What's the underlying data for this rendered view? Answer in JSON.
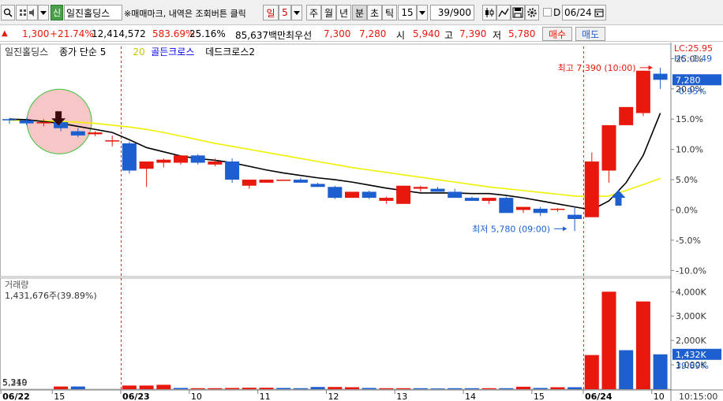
{
  "toolbar": {
    "search_icon": "magnifier-icon",
    "sym_badge": "신",
    "symbol": "일진홀딩스",
    "hint": "※매매마크, 내역은 조회버튼 클릭",
    "period_day": "일",
    "period_num": "5",
    "btn_week": "주",
    "btn_month": "월",
    "btn_year": "년",
    "btn_min": "분",
    "btn_sec": "초",
    "btn_tick": "틱",
    "interval": "15",
    "count": "39/900",
    "checkbox_label": "D",
    "date": "06/24"
  },
  "quote": {
    "change_icon": "up-triangle-icon",
    "change": "1,300",
    "change_pct": "+21.74%",
    "volume": "12,414,572",
    "volume_ratio": "583.69%",
    "turnover": "25.16%",
    "amount": "85,637백만",
    "best_quote_label": "최우선",
    "ask": "7,300",
    "bid": "7,280",
    "open_label": "시",
    "open": "5,940",
    "high_label": "고",
    "high": "7,390",
    "low_label": "저",
    "low": "5,780",
    "buy_btn": "매수",
    "sell_btn": "매도"
  },
  "colors": {
    "up": "#e8190c",
    "down": "#1e5fd0",
    "ma5": "#000000",
    "ma20": "#f0f000",
    "grid_red": "#d22",
    "current_box": "#1e5fd0"
  },
  "chart_data": {
    "type": "candlestick",
    "price": {
      "legend": [
        {
          "text": "일진홀딩스",
          "color": "#000000"
        },
        {
          "text": "종가 단순 5",
          "color": "#000000"
        },
        {
          "text": "20",
          "color": "#c8c800"
        },
        {
          "text": "골든크로스",
          "color": "#0000ff"
        },
        {
          "text": "데드크로스2",
          "color": "#000000"
        }
      ],
      "right_top_labels": [
        "LC:25.95",
        "HC:-1.49"
      ],
      "yticks": [
        "25.0%",
        "20.0%",
        "15.0%",
        "10.0%",
        "5.0%",
        "0.0%",
        "-5.0%",
        "-10.0%"
      ],
      "ytick_values": [
        25,
        20,
        15,
        10,
        5,
        0,
        -5,
        -10
      ],
      "ylim": [
        -11,
        27
      ],
      "current_price": "7,280",
      "current_pct": "-0.95%",
      "high_annotation": "최고 7,390 (10:00)",
      "low_annotation": "최저 5,780 (09:00)",
      "candles": [
        {
          "o": 15.0,
          "h": 15.2,
          "l": 14.2,
          "c": 14.8
        },
        {
          "o": 14.8,
          "h": 15.2,
          "l": 14.0,
          "c": 14.3
        },
        {
          "o": 14.3,
          "h": 15.0,
          "l": 13.8,
          "c": 14.5
        },
        {
          "o": 14.5,
          "h": 15.0,
          "l": 13.0,
          "c": 13.5
        },
        {
          "o": 13.0,
          "h": 13.5,
          "l": 12.0,
          "c": 12.3
        },
        {
          "o": 12.5,
          "h": 13.0,
          "l": 12.2,
          "c": 12.8
        },
        {
          "o": 11.5,
          "h": 12.3,
          "l": 10.5,
          "c": 11.5
        },
        {
          "o": 11.0,
          "h": 11.3,
          "l": 6.0,
          "c": 6.5
        },
        {
          "o": 6.8,
          "h": 7.5,
          "l": 3.8,
          "c": 8.0
        },
        {
          "o": 7.8,
          "h": 8.5,
          "l": 7.0,
          "c": 8.3
        },
        {
          "o": 7.8,
          "h": 9.0,
          "l": 7.5,
          "c": 9.0
        },
        {
          "o": 9.0,
          "h": 9.2,
          "l": 7.5,
          "c": 7.8
        },
        {
          "o": 7.5,
          "h": 8.5,
          "l": 7.2,
          "c": 8.0
        },
        {
          "o": 8.0,
          "h": 8.5,
          "l": 4.5,
          "c": 5.0
        },
        {
          "o": 4.0,
          "h": 5.0,
          "l": 3.5,
          "c": 5.0
        },
        {
          "o": 4.5,
          "h": 5.0,
          "l": 4.5,
          "c": 5.0
        },
        {
          "o": 4.8,
          "h": 5.0,
          "l": 4.8,
          "c": 5.0
        },
        {
          "o": 5.0,
          "h": 5.3,
          "l": 4.5,
          "c": 4.5
        },
        {
          "o": 4.3,
          "h": 4.5,
          "l": 3.8,
          "c": 3.8
        },
        {
          "o": 3.8,
          "h": 4.0,
          "l": 1.8,
          "c": 2.0
        },
        {
          "o": 2.0,
          "h": 3.0,
          "l": 2.0,
          "c": 3.0
        },
        {
          "o": 3.0,
          "h": 3.2,
          "l": 1.8,
          "c": 2.0
        },
        {
          "o": 1.5,
          "h": 2.2,
          "l": 1.0,
          "c": 2.0
        },
        {
          "o": 1.0,
          "h": 4.0,
          "l": 1.0,
          "c": 4.0
        },
        {
          "o": 3.5,
          "h": 4.0,
          "l": 3.0,
          "c": 3.8
        },
        {
          "o": 3.5,
          "h": 3.8,
          "l": 3.0,
          "c": 3.0
        },
        {
          "o": 3.0,
          "h": 3.5,
          "l": 2.0,
          "c": 2.0
        },
        {
          "o": 2.0,
          "h": 2.2,
          "l": 1.5,
          "c": 1.5
        },
        {
          "o": 1.5,
          "h": 2.0,
          "l": 1.0,
          "c": 2.0
        },
        {
          "o": 2.0,
          "h": 2.2,
          "l": -0.5,
          "c": -0.5
        },
        {
          "o": 0.0,
          "h": 0.5,
          "l": -0.5,
          "c": 0.5
        },
        {
          "o": 0.2,
          "h": 0.5,
          "l": -1.0,
          "c": -0.5
        },
        {
          "o": 0.0,
          "h": 0.3,
          "l": -0.3,
          "c": 0.2
        },
        {
          "o": -0.8,
          "h": 0.5,
          "l": -3.5,
          "c": -1.5
        },
        {
          "o": -1.2,
          "h": 9.5,
          "l": -1.2,
          "c": 8.0
        },
        {
          "o": 6.5,
          "h": 14.0,
          "l": 4.5,
          "c": 14.0
        },
        {
          "o": 14.0,
          "h": 17.0,
          "l": 14.0,
          "c": 17.0
        },
        {
          "o": 16.0,
          "h": 23.0,
          "l": 15.5,
          "c": 23.0
        },
        {
          "o": 22.5,
          "h": 23.5,
          "l": 20.0,
          "c": 21.5
        }
      ],
      "ma5": [
        15.0,
        14.9,
        14.6,
        14.3,
        13.8,
        13.3,
        12.8,
        11.6,
        10.3,
        9.6,
        8.9,
        8.5,
        8.2,
        7.8,
        7.2,
        6.6,
        6.1,
        5.7,
        5.3,
        5.0,
        4.6,
        4.1,
        3.6,
        3.2,
        2.8,
        2.8,
        2.8,
        2.7,
        2.7,
        2.4,
        2.0,
        1.5,
        1.0,
        0.5,
        0.0,
        1.5,
        4.5,
        9.0,
        16.0
      ],
      "ma20": [
        14.8,
        14.8,
        14.7,
        14.6,
        14.5,
        14.3,
        14.0,
        13.7,
        13.3,
        12.8,
        12.2,
        11.6,
        11.0,
        10.5,
        10.0,
        9.5,
        9.0,
        8.5,
        8.0,
        7.5,
        7.0,
        6.6,
        6.2,
        5.8,
        5.4,
        5.0,
        4.6,
        4.2,
        3.8,
        3.5,
        3.2,
        2.9,
        2.6,
        2.3,
        2.2,
        2.3,
        3.2,
        4.2,
        5.2
      ],
      "golden_cross_index": 35,
      "dead_cross_index": 3
    },
    "volume": {
      "title": "거래량",
      "summary": "1,431,676주(39.89%)",
      "bottom_labels": [
        "5,349",
        "5,210"
      ],
      "yticks": [
        "4,000K",
        "3,000K",
        "2,000K",
        "1,000K"
      ],
      "ytick_values": [
        4000,
        3000,
        2000,
        1000
      ],
      "ylim": [
        0,
        4300
      ],
      "current_value": "1,432K",
      "current_pct": "39.89%",
      "values": [
        0,
        0,
        0,
        110,
        110,
        0,
        0,
        150,
        150,
        180,
        50,
        40,
        40,
        50,
        60,
        60,
        50,
        40,
        90,
        90,
        80,
        50,
        40,
        40,
        40,
        30,
        40,
        40,
        40,
        40,
        100,
        50,
        80,
        80,
        1400,
        4000,
        1600,
        3600,
        1430
      ],
      "up": [
        true,
        false,
        true,
        true,
        false,
        true,
        false,
        true,
        true,
        true,
        false,
        true,
        true,
        true,
        true,
        true,
        false,
        false,
        false,
        true,
        true,
        false,
        true,
        true,
        false,
        false,
        false,
        false,
        true,
        false,
        true,
        false,
        true,
        false,
        true,
        true,
        false,
        true,
        false
      ]
    },
    "xticks": [
      {
        "label": "06/22",
        "index": 0,
        "bold": true
      },
      {
        "label": "15",
        "index": 3
      },
      {
        "label": "06/23",
        "index": 7,
        "bold": true
      },
      {
        "label": "10",
        "index": 11
      },
      {
        "label": "11",
        "index": 15
      },
      {
        "label": "12",
        "index": 19
      },
      {
        "label": "13",
        "index": 23
      },
      {
        "label": "14",
        "index": 27
      },
      {
        "label": "15",
        "index": 31
      },
      {
        "label": "06/24",
        "index": 34,
        "bold": true
      },
      {
        "label": "10",
        "index": 38
      }
    ],
    "day_separators": [
      7,
      34
    ],
    "time_label": "10:15:00"
  }
}
